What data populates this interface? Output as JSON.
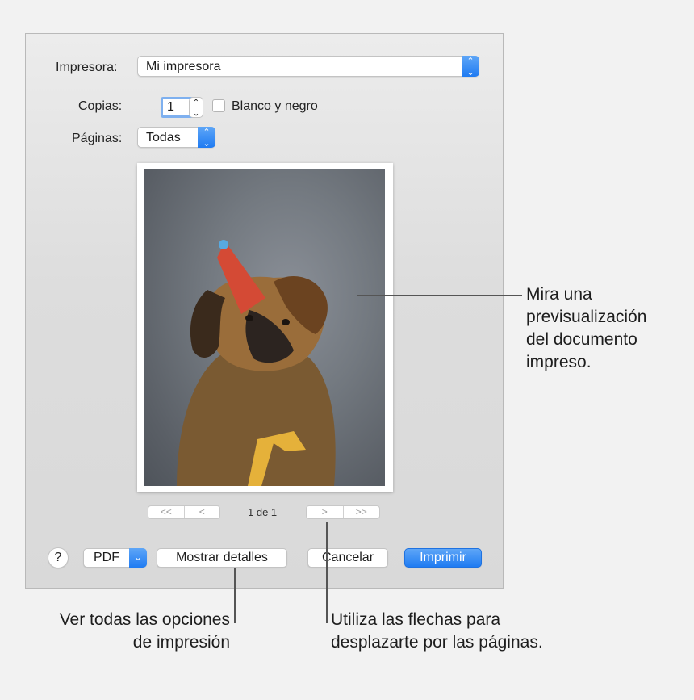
{
  "dialog": {
    "printer_label": "Impresora:",
    "printer_value": "Mi impresora",
    "copies_label": "Copias:",
    "copies_value": "1",
    "bw_label": "Blanco y negro",
    "bw_checked": false,
    "pages_label": "Páginas:",
    "pages_value": "Todas",
    "page_indicator": "1 de 1",
    "nav": {
      "first": "<<",
      "prev": "<",
      "next": ">",
      "last": ">>"
    },
    "help_label": "?",
    "pdf_label": "PDF",
    "details_label": "Mostrar detalles",
    "cancel_label": "Cancelar",
    "print_label": "Imprimir"
  },
  "callouts": {
    "preview": [
      "Mira una",
      "previsualización",
      "del documento",
      "impreso."
    ],
    "details": [
      "Ver todas las opciones",
      "de impresión"
    ],
    "arrows": [
      "Utiliza las flechas para",
      "desplazarte por las páginas."
    ]
  },
  "colors": {
    "accent": "#1f7bf2",
    "focus_ring": "#7eb0ef"
  }
}
